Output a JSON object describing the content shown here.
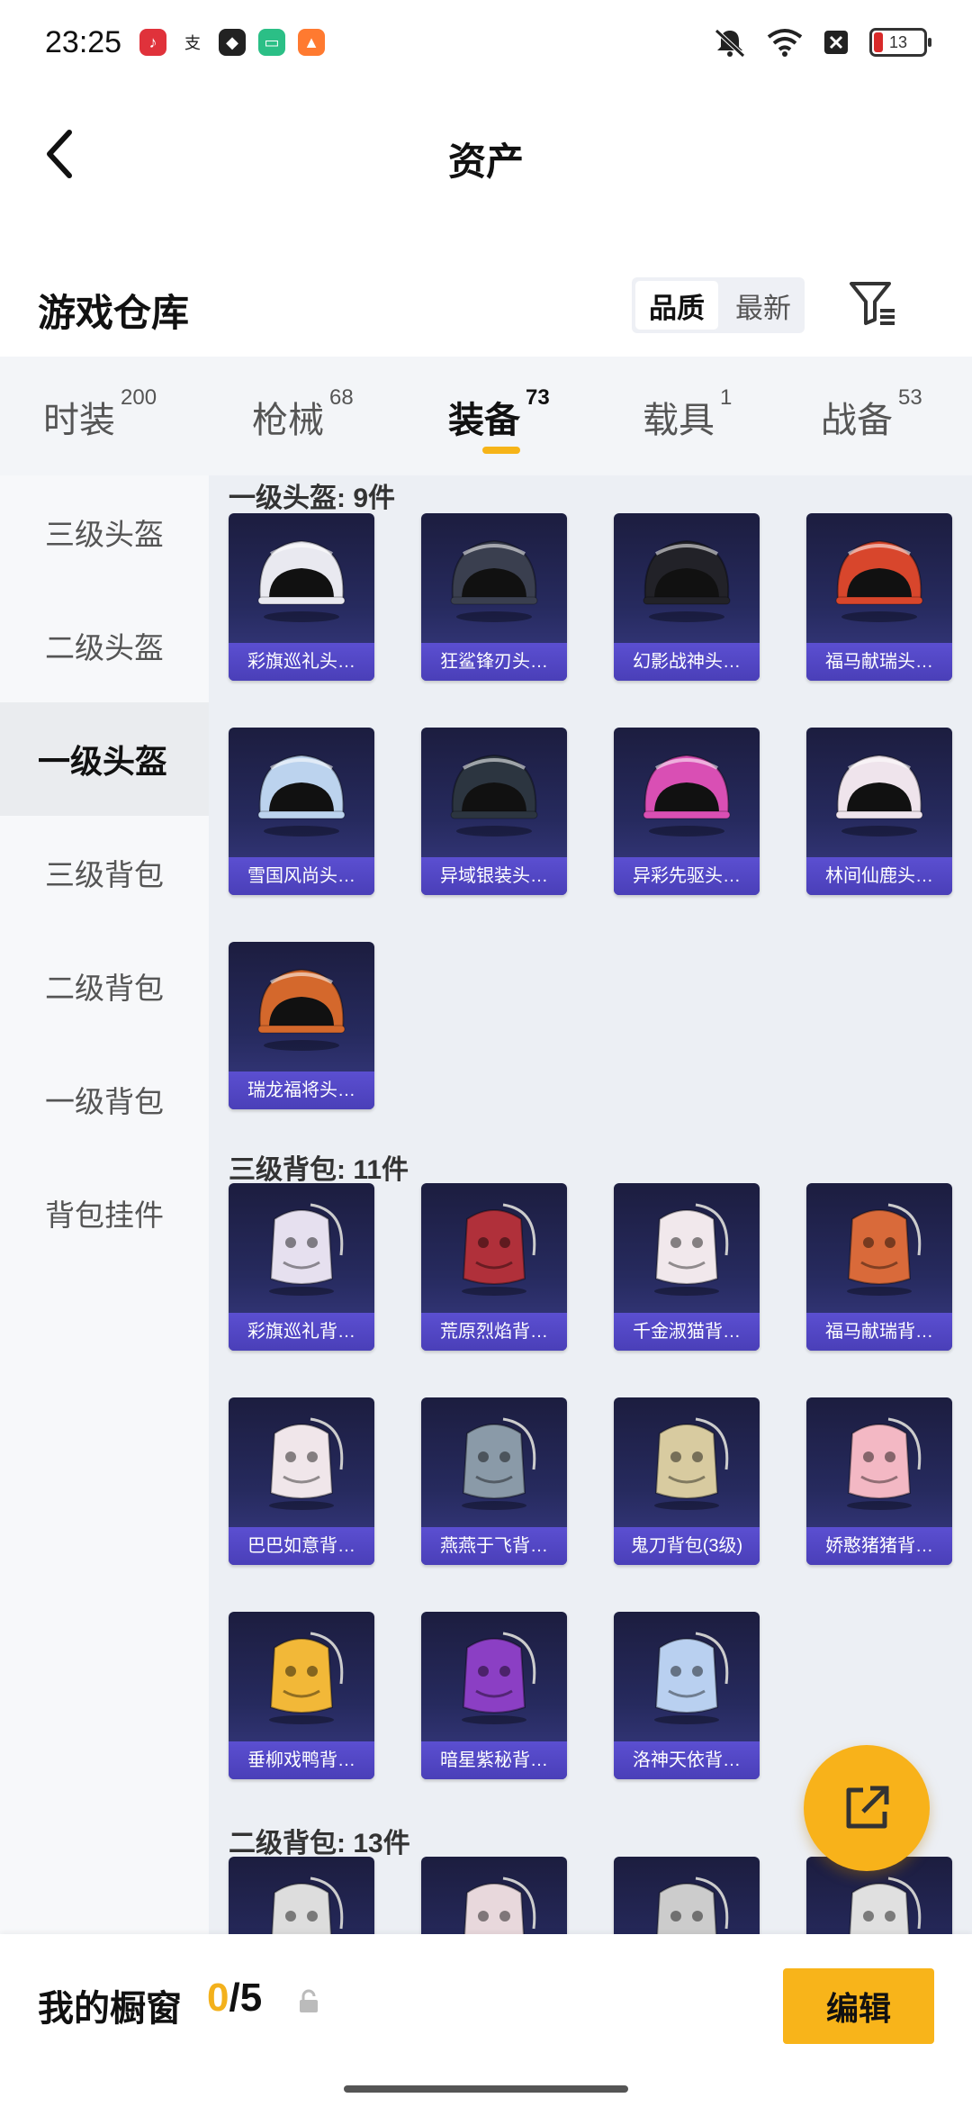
{
  "status_bar": {
    "time": "23:25",
    "apps": [
      {
        "icon": "music-app-icon",
        "color": "#e0323b"
      },
      {
        "icon": "alipay-icon",
        "color": "#ffffff"
      },
      {
        "icon": "shield-app-icon",
        "color": "#ffffff"
      },
      {
        "icon": "wallet-app-icon",
        "color": "#2bbf86"
      },
      {
        "icon": "game-app-icon",
        "color": "#ff7a30"
      }
    ],
    "battery": "13",
    "battery_color": "#d82a2a"
  },
  "header": {
    "title": "资产"
  },
  "section": {
    "title": "游戏仓库",
    "sort_options": [
      "品质",
      "最新"
    ]
  },
  "tabs": [
    {
      "label": "时装",
      "count": "200"
    },
    {
      "label": "枪械",
      "count": "68"
    },
    {
      "label": "装备",
      "count": "73"
    },
    {
      "label": "载具",
      "count": "1"
    },
    {
      "label": "战备",
      "count": "53"
    }
  ],
  "active_tab_color": "#f6b418",
  "sidebar": [
    {
      "label": "三级头盔"
    },
    {
      "label": "二级头盔"
    },
    {
      "label": "一级头盔"
    },
    {
      "label": "三级背包"
    },
    {
      "label": "二级背包"
    },
    {
      "label": "一级背包"
    },
    {
      "label": "背包挂件"
    }
  ],
  "groups": [
    {
      "title": "一级头盔: 9件",
      "items": [
        {
          "name": "彩旗巡礼头…",
          "icon": "helmet-icon",
          "color": "#e9e9f0"
        },
        {
          "name": "狂鲨锋刃头…",
          "icon": "helmet-icon",
          "color": "#3a3f4f"
        },
        {
          "name": "幻影战神头…",
          "icon": "helmet-icon",
          "color": "#222228"
        },
        {
          "name": "福马献瑞头…",
          "icon": "helmet-icon",
          "color": "#d8462c"
        },
        {
          "name": "雪国风尚头…",
          "icon": "helmet-icon",
          "color": "#bcd3ee"
        },
        {
          "name": "异域银装头…",
          "icon": "helmet-icon",
          "color": "#2c3540"
        },
        {
          "name": "异彩先驱头…",
          "icon": "helmet-icon",
          "color": "#d94fb4"
        },
        {
          "name": "林间仙鹿头…",
          "icon": "helmet-icon",
          "color": "#efe4ec"
        },
        {
          "name": "瑞龙福将头…",
          "icon": "helmet-icon",
          "color": "#d4682c"
        }
      ]
    },
    {
      "title": "三级背包: 11件",
      "items": [
        {
          "name": "彩旗巡礼背…",
          "icon": "backpack-icon",
          "color": "#e6e0ef"
        },
        {
          "name": "荒原烈焰背…",
          "icon": "backpack-icon",
          "color": "#b0303a"
        },
        {
          "name": "千金淑猫背…",
          "icon": "backpack-icon",
          "color": "#f1e8ec"
        },
        {
          "name": "福马献瑞背…",
          "icon": "backpack-icon",
          "color": "#d96a3a"
        },
        {
          "name": "巴巴如意背…",
          "icon": "backpack-icon",
          "color": "#f0e6ea"
        },
        {
          "name": "燕燕于飞背…",
          "icon": "backpack-icon",
          "color": "#8a9aa8"
        },
        {
          "name": "鬼刀背包(3级)",
          "icon": "backpack-icon",
          "color": "#d8cba0"
        },
        {
          "name": "娇憨猪猪背…",
          "icon": "backpack-icon",
          "color": "#f3b8c4"
        },
        {
          "name": "垂柳戏鸭背…",
          "icon": "backpack-icon",
          "color": "#f2b838"
        },
        {
          "name": "暗星紫秘背…",
          "icon": "backpack-icon",
          "color": "#8b3fc4"
        },
        {
          "name": "洛神天依背…",
          "icon": "backpack-icon",
          "color": "#b9d0f0"
        }
      ]
    },
    {
      "title": "二级背包: 13件",
      "items": [
        {
          "name": "",
          "icon": "backpack-icon",
          "color": "#dddddd"
        },
        {
          "name": "",
          "icon": "backpack-icon",
          "color": "#e8d8dc"
        },
        {
          "name": "",
          "icon": "backpack-icon",
          "color": "#cccccc"
        },
        {
          "name": "",
          "icon": "backpack-icon",
          "color": "#e0e0e0"
        }
      ]
    }
  ],
  "fab": {
    "icon": "share-external-icon"
  },
  "footer": {
    "label": "我的橱窗",
    "current": "0",
    "separator": "/5",
    "edit_label": "编辑"
  }
}
